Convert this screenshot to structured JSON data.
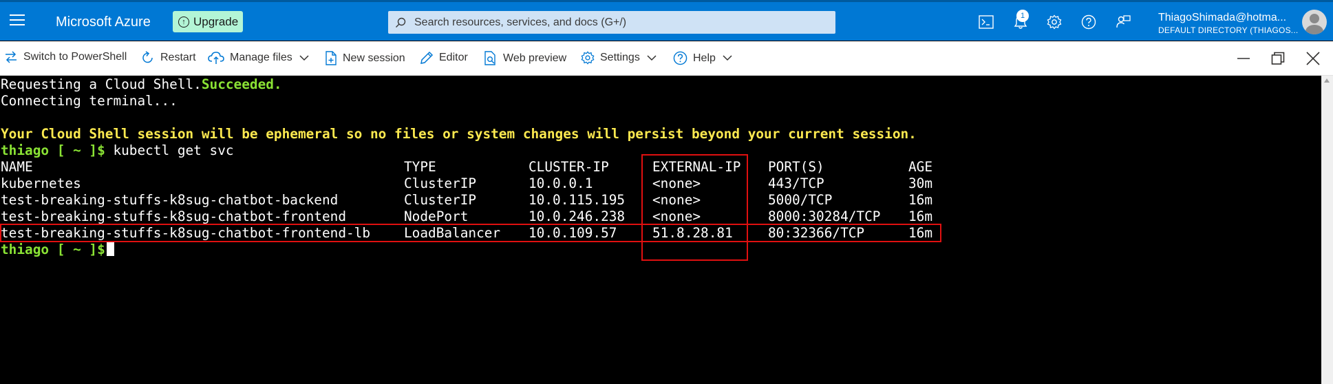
{
  "topbar": {
    "brand": "Microsoft Azure",
    "upgrade_label": "Upgrade",
    "search_placeholder": "Search resources, services, and docs (G+/)",
    "notification_count": "1",
    "account_email": "ThiagoShimada@hotma...",
    "account_directory": "DEFAULT DIRECTORY (THIAGOS...",
    "drag_handle": "..."
  },
  "toolbar": {
    "switch_label": "Switch to PowerShell",
    "restart_label": "Restart",
    "manage_files_label": "Manage files",
    "new_session_label": "New session",
    "editor_label": "Editor",
    "web_preview_label": "Web preview",
    "settings_label": "Settings",
    "help_label": "Help"
  },
  "terminal": {
    "line1_prefix": "Requesting a Cloud Shell.",
    "line1_status": "Succeeded.",
    "line2": "Connecting terminal...",
    "warning": "Your Cloud Shell session will be ephemeral so no files or system changes will persist beyond your current session.",
    "prompt": "thiago [ ~ ]$",
    "command": " kubectl get svc",
    "headers": [
      "NAME",
      "TYPE",
      "CLUSTER-IP",
      "EXTERNAL-IP",
      "PORT(S)",
      "AGE"
    ],
    "rows": [
      [
        "kubernetes",
        "ClusterIP",
        "10.0.0.1",
        "<none>",
        "443/TCP",
        "30m"
      ],
      [
        "test-breaking-stuffs-k8sug-chatbot-backend",
        "ClusterIP",
        "10.0.115.195",
        "<none>",
        "5000/TCP",
        "16m"
      ],
      [
        "test-breaking-stuffs-k8sug-chatbot-frontend",
        "NodePort",
        "10.0.246.238",
        "<none>",
        "8000:30284/TCP",
        "16m"
      ],
      [
        "test-breaking-stuffs-k8sug-chatbot-frontend-lb",
        "LoadBalancer",
        "10.0.109.57",
        "51.8.28.81",
        "80:32366/TCP",
        "16m"
      ]
    ],
    "final_prompt": "thiago [ ~ ]$"
  },
  "colors": {
    "azure_blue": "#0078d4",
    "prompt_green": "#8ae234",
    "warning_yellow": "#fce94f",
    "highlight_red": "#e01010"
  }
}
